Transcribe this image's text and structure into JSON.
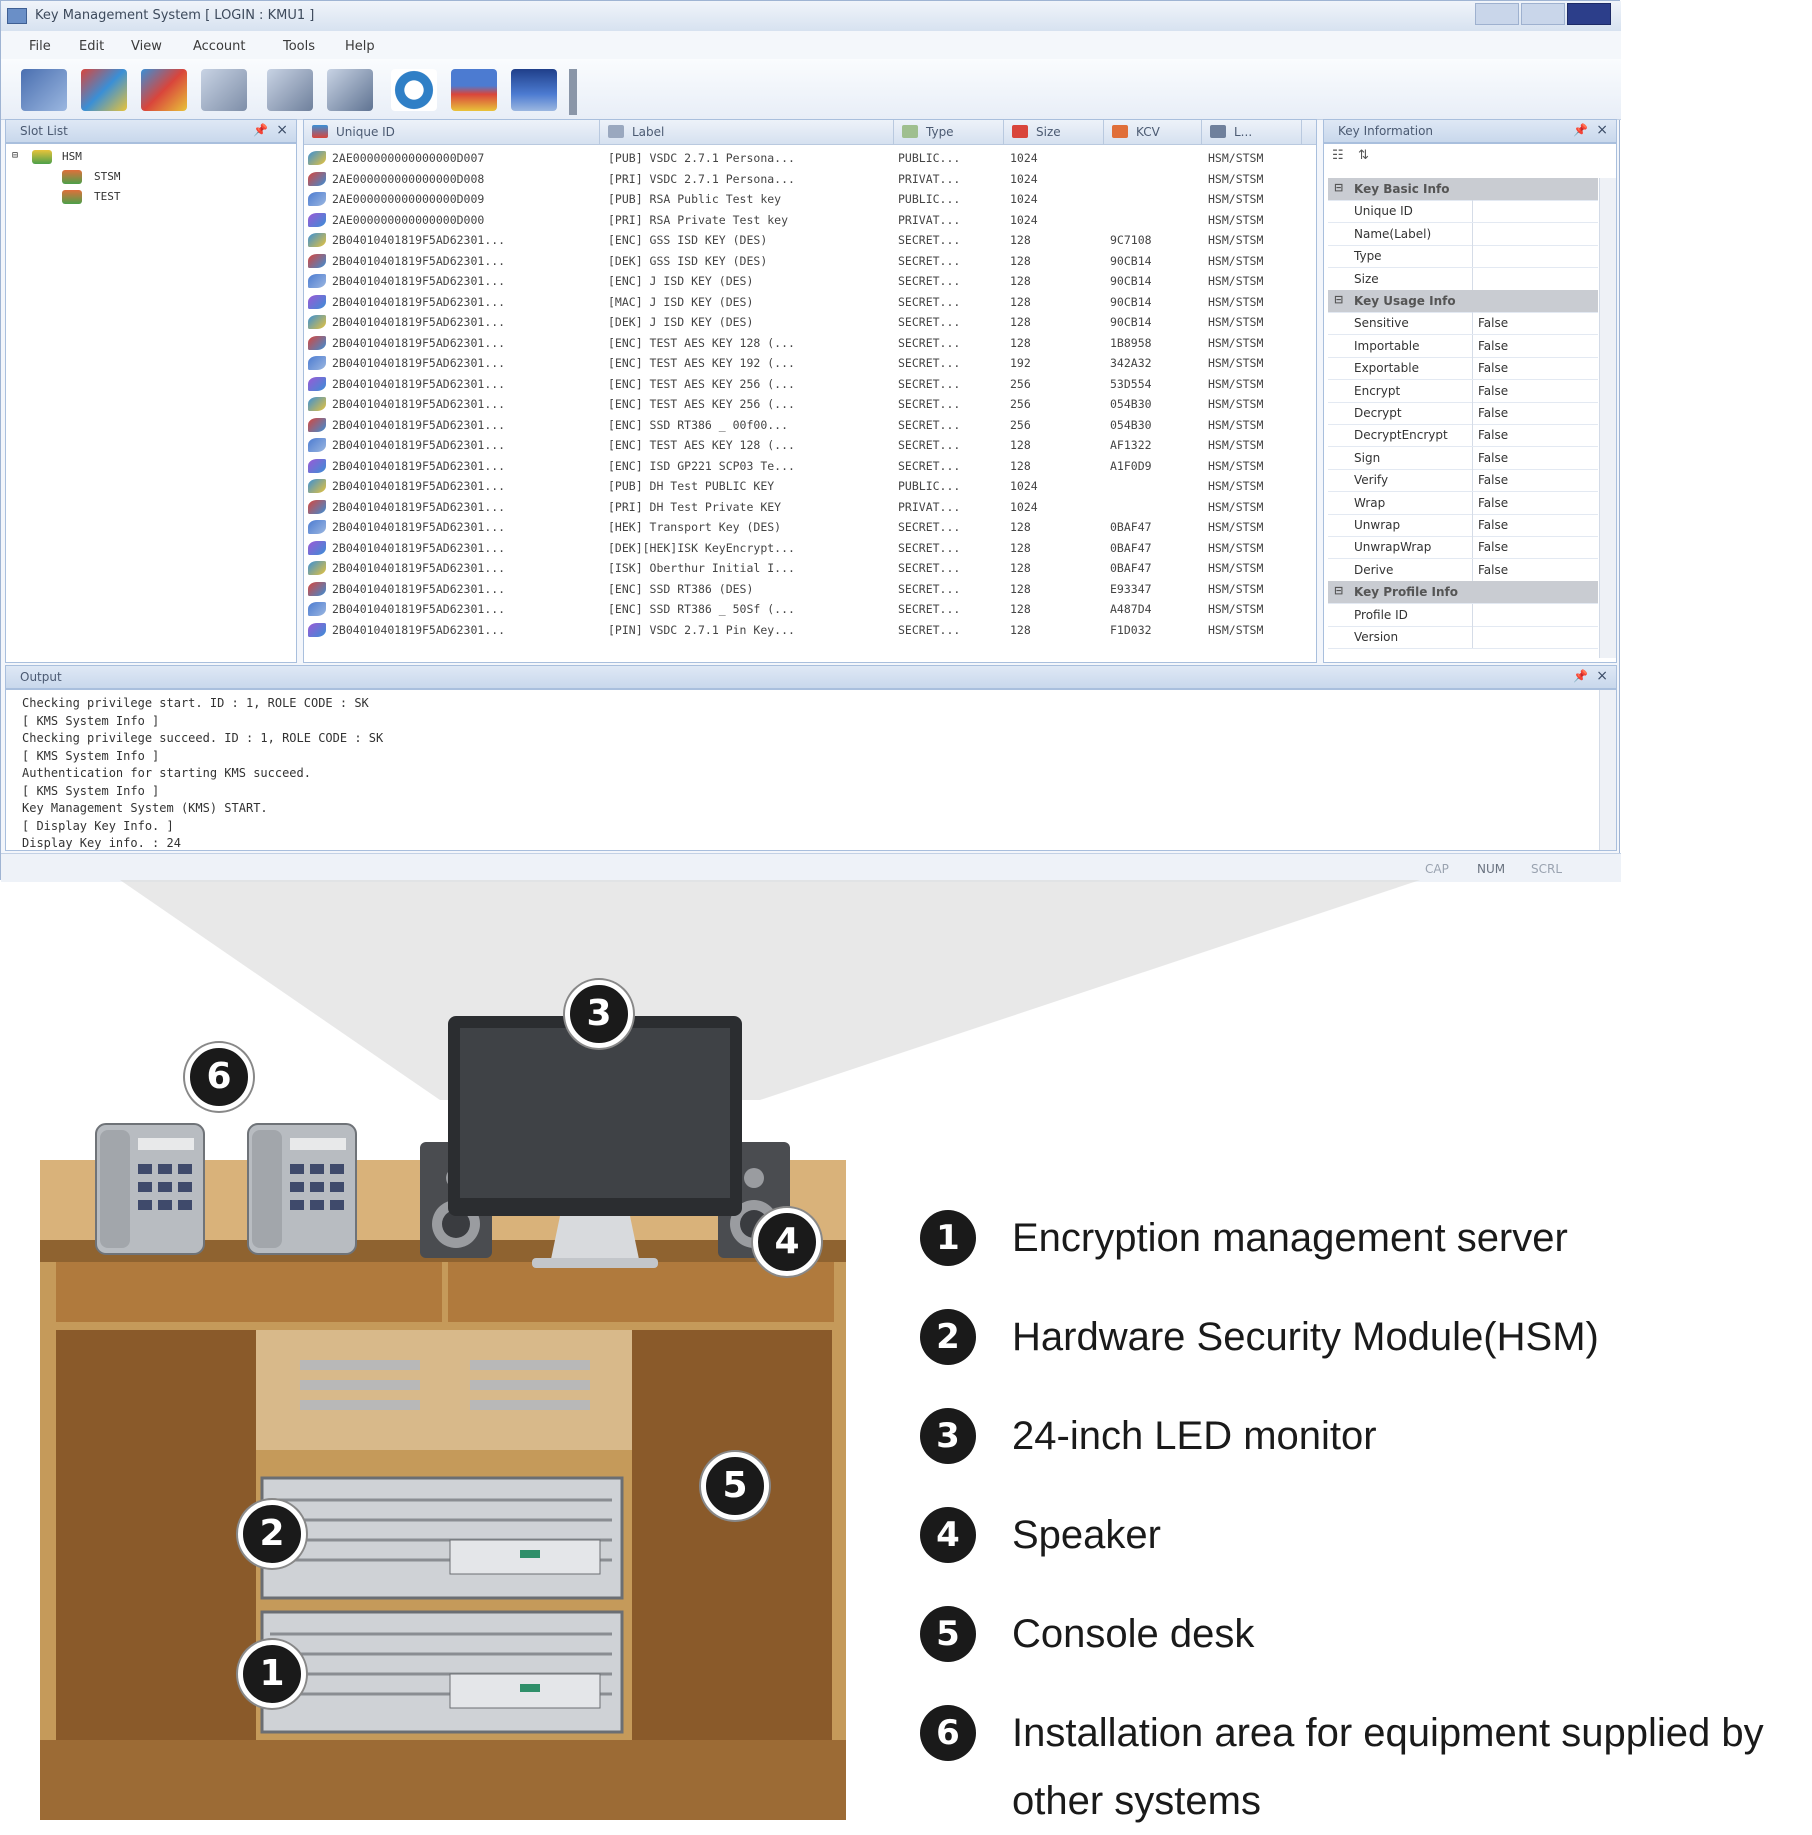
{
  "window": {
    "title": "Key Management System [ LOGIN : KMU1 ]",
    "menu": [
      "File",
      "Edit",
      "View",
      "Account",
      "Tools",
      "Help"
    ]
  },
  "slot_list": {
    "title": "Slot List",
    "root": "HSM",
    "children": [
      "STSM",
      "TEST"
    ]
  },
  "key_grid": {
    "columns": [
      "Unique ID",
      "Label",
      "Type",
      "Size",
      "KCV",
      "L..."
    ],
    "rows": [
      {
        "id": "2AE000000000000000D007",
        "label": "[PUB] VSDC 2.7.1 Persona...",
        "type": "PUBLIC...",
        "size": "1024",
        "kcv": "",
        "loc": "HSM/STSM"
      },
      {
        "id": "2AE000000000000000D008",
        "label": "[PRI] VSDC 2.7.1 Persona...",
        "type": "PRIVAT...",
        "size": "1024",
        "kcv": "",
        "loc": "HSM/STSM"
      },
      {
        "id": "2AE000000000000000D009",
        "label": "[PUB] RSA Public Test key",
        "type": "PUBLIC...",
        "size": "1024",
        "kcv": "",
        "loc": "HSM/STSM"
      },
      {
        "id": "2AE000000000000000D000",
        "label": "[PRI] RSA Private Test key",
        "type": "PRIVAT...",
        "size": "1024",
        "kcv": "",
        "loc": "HSM/STSM"
      },
      {
        "id": "2B04010401819F5AD62301...",
        "label": "[ENC] GSS ISD KEY (DES)",
        "type": "SECRET...",
        "size": "128",
        "kcv": "9C7108",
        "loc": "HSM/STSM"
      },
      {
        "id": "2B04010401819F5AD62301...",
        "label": "[DEK] GSS ISD KEY (DES)",
        "type": "SECRET...",
        "size": "128",
        "kcv": "90CB14",
        "loc": "HSM/STSM"
      },
      {
        "id": "2B04010401819F5AD62301...",
        "label": "[ENC] J ISD KEY (DES)",
        "type": "SECRET...",
        "size": "128",
        "kcv": "90CB14",
        "loc": "HSM/STSM"
      },
      {
        "id": "2B04010401819F5AD62301...",
        "label": "[MAC] J ISD KEY (DES)",
        "type": "SECRET...",
        "size": "128",
        "kcv": "90CB14",
        "loc": "HSM/STSM"
      },
      {
        "id": "2B04010401819F5AD62301...",
        "label": "[DEK] J ISD KEY (DES)",
        "type": "SECRET...",
        "size": "128",
        "kcv": "90CB14",
        "loc": "HSM/STSM"
      },
      {
        "id": "2B04010401819F5AD62301...",
        "label": "[ENC] TEST AES KEY 128 (...",
        "type": "SECRET...",
        "size": "128",
        "kcv": "1B8958",
        "loc": "HSM/STSM"
      },
      {
        "id": "2B04010401819F5AD62301...",
        "label": "[ENC] TEST AES KEY 192 (...",
        "type": "SECRET...",
        "size": "192",
        "kcv": "342A32",
        "loc": "HSM/STSM"
      },
      {
        "id": "2B04010401819F5AD62301...",
        "label": "[ENC] TEST AES KEY 256 (...",
        "type": "SECRET...",
        "size": "256",
        "kcv": "53D554",
        "loc": "HSM/STSM"
      },
      {
        "id": "2B04010401819F5AD62301...",
        "label": "[ENC] TEST AES KEY 256 (...",
        "type": "SECRET...",
        "size": "256",
        "kcv": "054B30",
        "loc": "HSM/STSM"
      },
      {
        "id": "2B04010401819F5AD62301...",
        "label": "[ENC] SSD RT386 _ 00f00...",
        "type": "SECRET...",
        "size": "256",
        "kcv": "054B30",
        "loc": "HSM/STSM"
      },
      {
        "id": "2B04010401819F5AD62301...",
        "label": "[ENC] TEST AES KEY 128 (...",
        "type": "SECRET...",
        "size": "128",
        "kcv": "AF1322",
        "loc": "HSM/STSM"
      },
      {
        "id": "2B04010401819F5AD62301...",
        "label": "[ENC] ISD GP221 SCP03 Te...",
        "type": "SECRET...",
        "size": "128",
        "kcv": "A1F0D9",
        "loc": "HSM/STSM"
      },
      {
        "id": "2B04010401819F5AD62301...",
        "label": "[PUB] DH Test PUBLIC KEY",
        "type": "PUBLIC...",
        "size": "1024",
        "kcv": "",
        "loc": "HSM/STSM"
      },
      {
        "id": "2B04010401819F5AD62301...",
        "label": "[PRI] DH Test Private KEY",
        "type": "PRIVAT...",
        "size": "1024",
        "kcv": "",
        "loc": "HSM/STSM"
      },
      {
        "id": "2B04010401819F5AD62301...",
        "label": "[HEK] Transport Key (DES)",
        "type": "SECRET...",
        "size": "128",
        "kcv": "0BAF47",
        "loc": "HSM/STSM"
      },
      {
        "id": "2B04010401819F5AD62301...",
        "label": "[DEK][HEK]ISK KeyEncrypt...",
        "type": "SECRET...",
        "size": "128",
        "kcv": "0BAF47",
        "loc": "HSM/STSM"
      },
      {
        "id": "2B04010401819F5AD62301...",
        "label": "[ISK] Oberthur Initial I...",
        "type": "SECRET...",
        "size": "128",
        "kcv": "0BAF47",
        "loc": "HSM/STSM"
      },
      {
        "id": "2B04010401819F5AD62301...",
        "label": "[ENC] SSD RT386 (DES)",
        "type": "SECRET...",
        "size": "128",
        "kcv": "E93347",
        "loc": "HSM/STSM"
      },
      {
        "id": "2B04010401819F5AD62301...",
        "label": "[ENC] SSD RT386 _ 50Sf (...",
        "type": "SECRET...",
        "size": "128",
        "kcv": "A487D4",
        "loc": "HSM/STSM"
      },
      {
        "id": "2B04010401819F5AD62301...",
        "label": "[PIN] VSDC 2.7.1 Pin Key...",
        "type": "SECRET...",
        "size": "128",
        "kcv": "F1D032",
        "loc": "HSM/STSM"
      }
    ]
  },
  "key_info": {
    "title": "Key Information",
    "rows": [
      {
        "cat": true,
        "k": "Key Basic Info",
        "v": ""
      },
      {
        "cat": false,
        "k": "Unique ID",
        "v": ""
      },
      {
        "cat": false,
        "k": "Name(Label)",
        "v": ""
      },
      {
        "cat": false,
        "k": "Type",
        "v": ""
      },
      {
        "cat": false,
        "k": "Size",
        "v": ""
      },
      {
        "cat": true,
        "k": "Key Usage Info",
        "v": ""
      },
      {
        "cat": false,
        "k": "Sensitive",
        "v": "False"
      },
      {
        "cat": false,
        "k": "Importable",
        "v": "False"
      },
      {
        "cat": false,
        "k": "Exportable",
        "v": "False"
      },
      {
        "cat": false,
        "k": "Encrypt",
        "v": "False"
      },
      {
        "cat": false,
        "k": "Decrypt",
        "v": "False"
      },
      {
        "cat": false,
        "k": "DecryptEncrypt",
        "v": "False"
      },
      {
        "cat": false,
        "k": "Sign",
        "v": "False"
      },
      {
        "cat": false,
        "k": "Verify",
        "v": "False"
      },
      {
        "cat": false,
        "k": "Wrap",
        "v": "False"
      },
      {
        "cat": false,
        "k": "Unwrap",
        "v": "False"
      },
      {
        "cat": false,
        "k": "UnwrapWrap",
        "v": "False"
      },
      {
        "cat": false,
        "k": "Derive",
        "v": "False"
      },
      {
        "cat": true,
        "k": "Key Profile Info",
        "v": ""
      },
      {
        "cat": false,
        "k": "Profile ID",
        "v": ""
      },
      {
        "cat": false,
        "k": "Version",
        "v": ""
      }
    ]
  },
  "output": {
    "title": "Output",
    "lines": [
      "Checking privilege start. ID : 1, ROLE CODE : SK",
      "[ KMS System Info ]",
      "Checking privilege succeed. ID : 1, ROLE CODE : SK",
      "[ KMS System Info ]",
      "Authentication for starting KMS succeed.",
      "[ KMS System Info ]",
      "Key Management System (KMS) START.",
      "[ Display Key Info. ]",
      "Display Key info. : 24"
    ]
  },
  "status": [
    "CAP",
    "NUM",
    "SCRL"
  ],
  "badges": [
    "1",
    "2",
    "3",
    "4",
    "5",
    "6"
  ],
  "legend": [
    {
      "num": "1",
      "text": "Encryption management server"
    },
    {
      "num": "2",
      "text": "Hardware Security Module(HSM)"
    },
    {
      "num": "3",
      "text": "24-inch LED monitor"
    },
    {
      "num": "4",
      "text": "Speaker"
    },
    {
      "num": "5",
      "text": "Console desk"
    },
    {
      "num": "6",
      "text": "Installation area for equipment supplied by other systems"
    }
  ],
  "colors": {
    "desk_wood": "#b8853f",
    "desk_dark": "#7a4d22",
    "panel_head": "#c9d8ec",
    "badge": "#1a1a1a"
  }
}
